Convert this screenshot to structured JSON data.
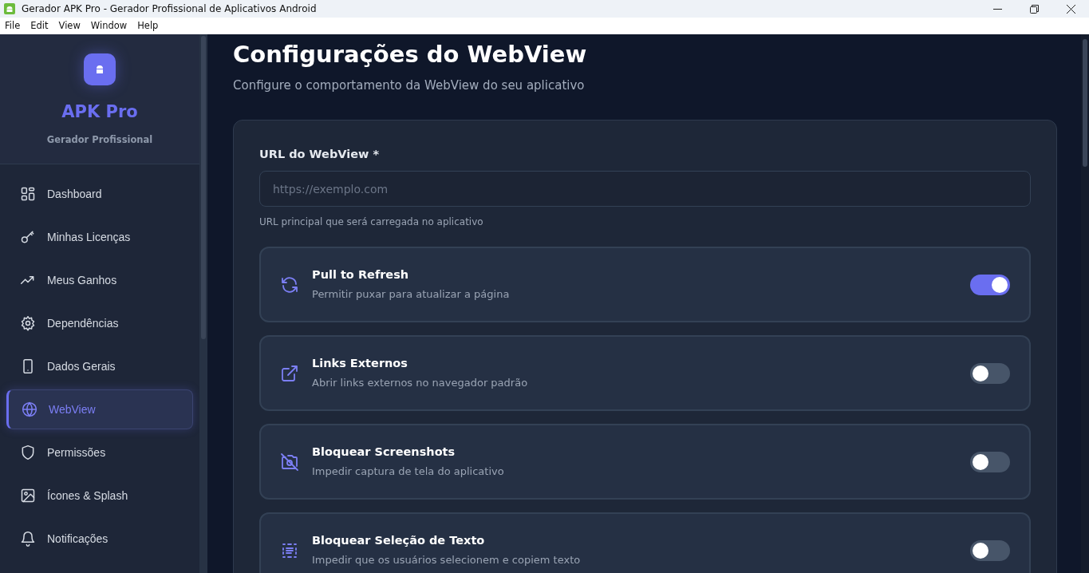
{
  "window": {
    "title": "Gerador APK Pro - Gerador Profissional de Aplicativos Android"
  },
  "menu": [
    "File",
    "Edit",
    "View",
    "Window",
    "Help"
  ],
  "sidebar": {
    "brand": "APK Pro",
    "subtitle": "Gerador Profissional",
    "items": [
      {
        "label": "Dashboard",
        "selected": false
      },
      {
        "label": "Minhas Licenças",
        "selected": false
      },
      {
        "label": "Meus Ganhos",
        "selected": false
      },
      {
        "label": "Dependências",
        "selected": false
      },
      {
        "label": "Dados Gerais",
        "selected": false
      },
      {
        "label": "WebView",
        "selected": true
      },
      {
        "label": "Permissões",
        "selected": false
      },
      {
        "label": "Ícones & Splash",
        "selected": false
      },
      {
        "label": "Notificações",
        "selected": false
      }
    ]
  },
  "page": {
    "title": "Configurações do WebView",
    "subtitle": "Configure o comportamento da WebView do seu aplicativo"
  },
  "url_field": {
    "label": "URL do WebView *",
    "placeholder": "https://exemplo.com",
    "help": "URL principal que será carregada no aplicativo"
  },
  "settings": [
    {
      "title": "Pull to Refresh",
      "description": "Permitir puxar para atualizar a página",
      "on": true
    },
    {
      "title": "Links Externos",
      "description": "Abrir links externos no navegador padrão",
      "on": false
    },
    {
      "title": "Bloquear Screenshots",
      "description": "Impedir captura de tela do aplicativo",
      "on": false
    },
    {
      "title": "Bloquear Seleção de Texto",
      "description": "Impedir que os usuários selecionem e copiem texto",
      "on": false
    }
  ]
}
